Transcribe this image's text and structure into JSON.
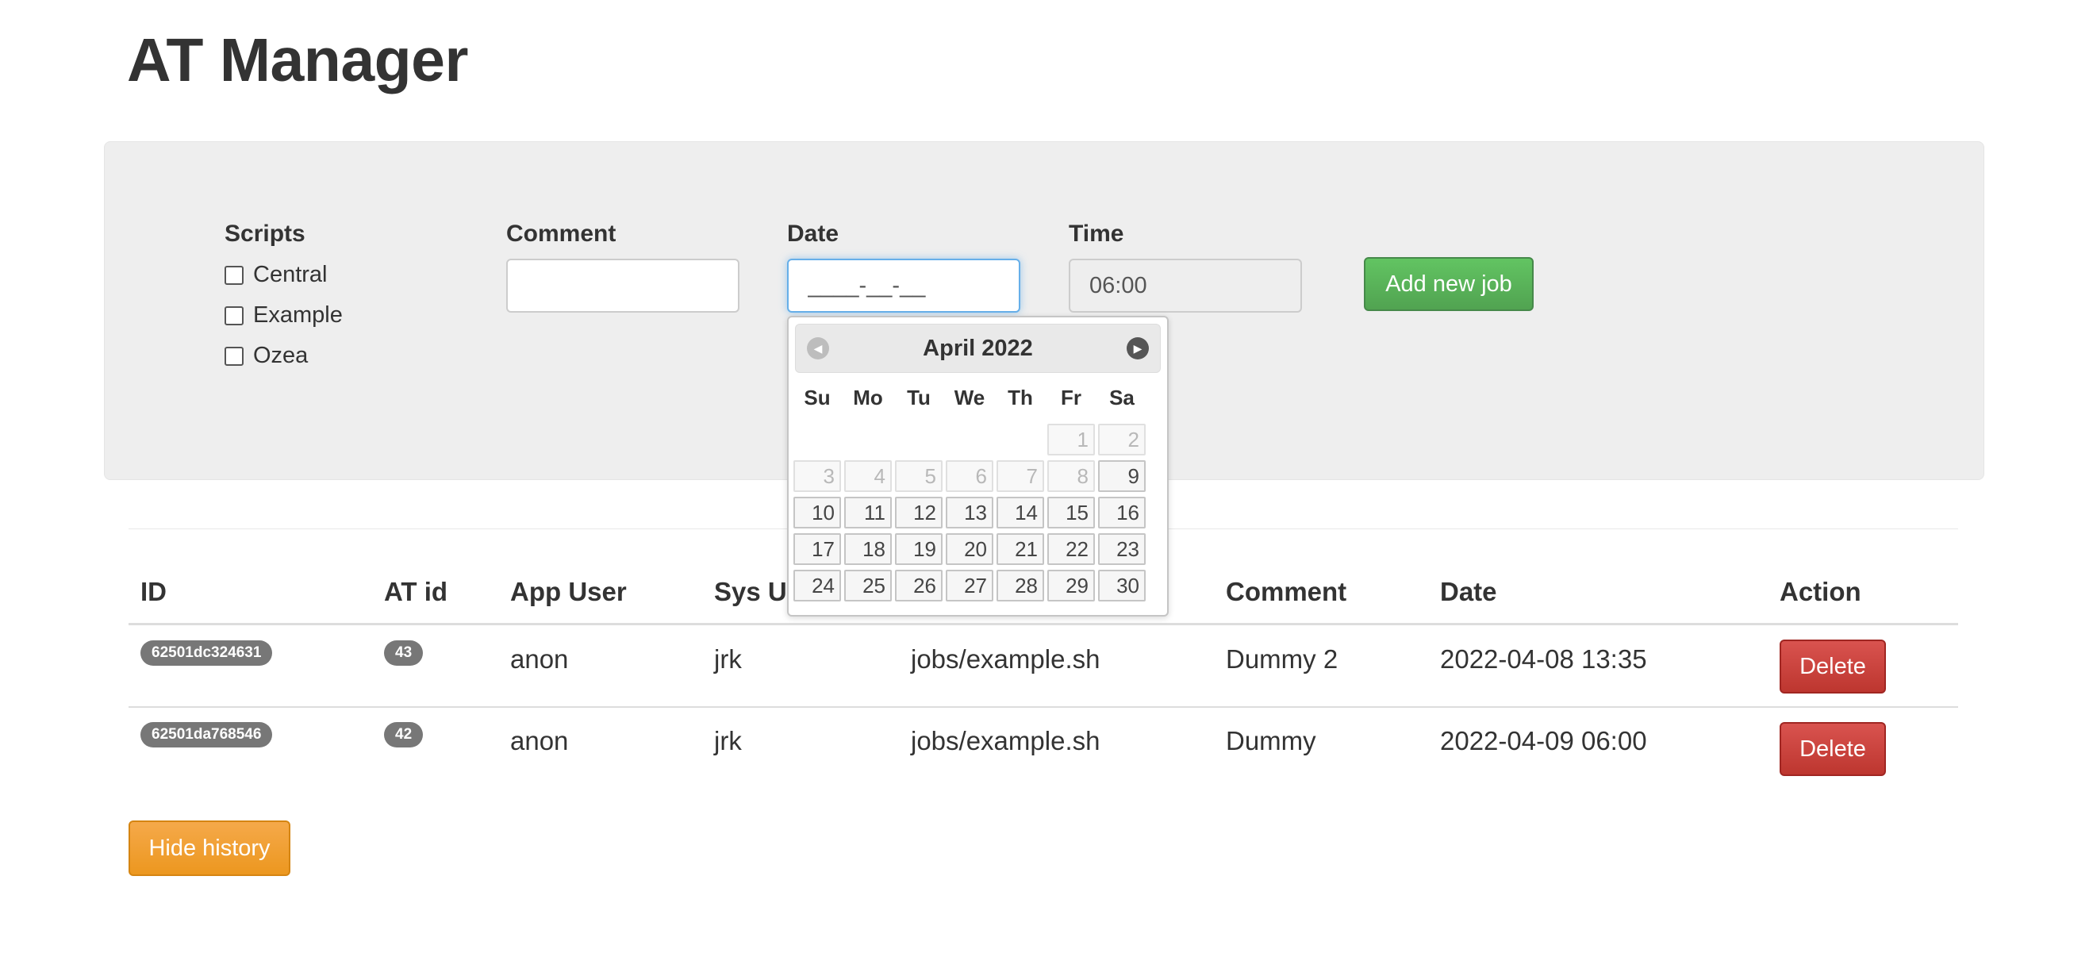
{
  "page": {
    "title": "AT Manager"
  },
  "form": {
    "scripts_label": "Scripts",
    "scripts": [
      "Central",
      "Example",
      "Ozea"
    ],
    "comment_label": "Comment",
    "comment_value": "",
    "date_label": "Date",
    "date_value": "____-__-__",
    "time_label": "Time",
    "time_value": "06:00",
    "add_button": "Add new job"
  },
  "datepicker": {
    "title": "April 2022",
    "prev_icon": "circle-triangle-left-icon",
    "next_icon": "circle-triangle-right-icon",
    "weekdays": [
      "Su",
      "Mo",
      "Tu",
      "We",
      "Th",
      "Fr",
      "Sa"
    ],
    "weeks": [
      [
        "",
        "",
        "",
        "",
        "",
        "1",
        "2"
      ],
      [
        "3",
        "4",
        "5",
        "6",
        "7",
        "8",
        "9"
      ],
      [
        "10",
        "11",
        "12",
        "13",
        "14",
        "15",
        "16"
      ],
      [
        "17",
        "18",
        "19",
        "20",
        "21",
        "22",
        "23"
      ],
      [
        "24",
        "25",
        "26",
        "27",
        "28",
        "29",
        "30"
      ]
    ],
    "disabled_days": [
      "1",
      "2",
      "3",
      "4",
      "5",
      "6",
      "7",
      "8"
    ]
  },
  "table": {
    "headers": [
      "ID",
      "AT id",
      "App User",
      "Sys Us",
      "Comment",
      "Date",
      "Action"
    ],
    "rows": [
      {
        "id": "62501dc324631",
        "at_id": "43",
        "app_user": "anon",
        "sys_user": "jrk",
        "script": "jobs/example.sh",
        "comment": "Dummy 2",
        "date": "2022-04-08 13:35",
        "action": "Delete"
      },
      {
        "id": "62501da768546",
        "at_id": "42",
        "app_user": "anon",
        "sys_user": "jrk",
        "script": "jobs/example.sh",
        "comment": "Dummy",
        "date": "2022-04-09 06:00",
        "action": "Delete"
      }
    ]
  },
  "history_button": "Hide history",
  "colors": {
    "success": "#5bb75b",
    "danger": "#d9534f",
    "warning": "#f0ad4e",
    "badge": "#777777",
    "well": "#eeeeee"
  }
}
